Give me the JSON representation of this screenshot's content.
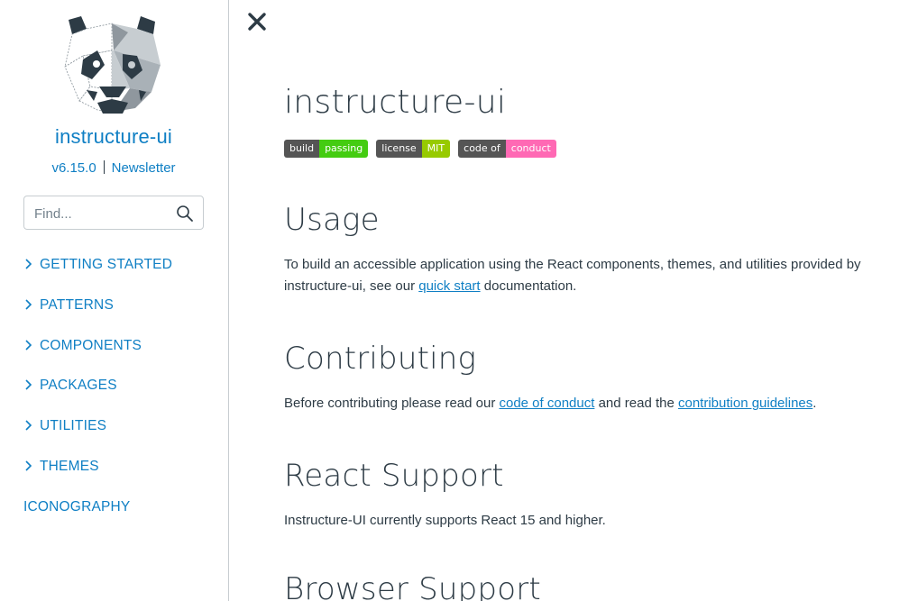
{
  "sidebar": {
    "title": "instructure-ui",
    "version": "v6.15.0",
    "newsletter": "Newsletter",
    "search": {
      "placeholder": "Find..."
    },
    "nav": [
      {
        "label": "GETTING STARTED",
        "expandable": true
      },
      {
        "label": "PATTERNS",
        "expandable": true
      },
      {
        "label": "COMPONENTS",
        "expandable": true
      },
      {
        "label": "PACKAGES",
        "expandable": true
      },
      {
        "label": "UTILITIES",
        "expandable": true
      },
      {
        "label": "THEMES",
        "expandable": true
      },
      {
        "label": "ICONOGRAPHY",
        "expandable": false
      }
    ]
  },
  "colors": {
    "accent": "#0f7fc4",
    "text": "#2d3b45",
    "border": "#c7cdd1"
  },
  "icons": {
    "close": "close-icon",
    "search": "search-icon",
    "chevron": "chevron-right-icon",
    "logo": "panda-logo"
  },
  "main": {
    "title": "instructure-ui",
    "badges": [
      {
        "key": "build",
        "value": "passing",
        "color": "#44cc11"
      },
      {
        "key": "license",
        "value": "MIT",
        "color": "#97ca00"
      },
      {
        "key": "code of",
        "value": "conduct",
        "color": "#ff69b4"
      }
    ],
    "usage": {
      "heading": "Usage",
      "text_before": "To build an accessible application using the React components, themes, and utilities provided by instructure-ui, see our ",
      "link": "quick start",
      "text_after": " documentation."
    },
    "contributing": {
      "heading": "Contributing",
      "text_before": "Before contributing please read our ",
      "link1": "code of conduct",
      "text_mid": " and read the ",
      "link2": "contribution guidelines",
      "text_after": "."
    },
    "react_support": {
      "heading": "React Support",
      "text": "Instructure-UI currently supports React 15 and higher."
    },
    "browser_support": {
      "heading": "Browser Support"
    }
  }
}
